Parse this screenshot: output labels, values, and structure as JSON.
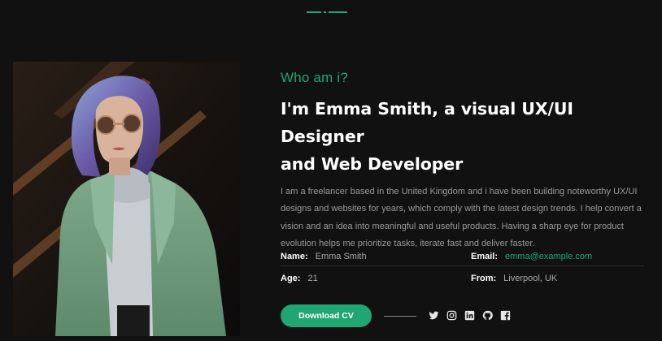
{
  "colors": {
    "background": "#111111",
    "accent": "#1fa672",
    "text_primary": "#ffffff",
    "text_muted": "#9a9a9a"
  },
  "about": {
    "eyebrow": "Who am i?",
    "headline_line1": "I'm Emma Smith, a visual UX/UI Designer",
    "headline_line2": "and Web Developer",
    "bio": "I am a freelancer based in the United Kingdom and i have been building noteworthy UX/UI designs and websites for years, which comply with the latest design trends. I help convert a vision and an idea into meaningful and useful products. Having a sharp eye for product evolution helps me prioritize tasks, iterate fast and deliver faster."
  },
  "info": {
    "name_label": "Name:",
    "name_value": "Emma Smith",
    "email_label": "Email:",
    "email_value": "emma@example.com",
    "age_label": "Age:",
    "age_value": "21",
    "from_label": "From:",
    "from_value": "Liverpool, UK"
  },
  "actions": {
    "download_label": "Download CV"
  },
  "socials": [
    {
      "icon": "twitter-icon"
    },
    {
      "icon": "instagram-icon"
    },
    {
      "icon": "linkedin-icon"
    },
    {
      "icon": "github-icon"
    },
    {
      "icon": "facebook-icon"
    }
  ]
}
